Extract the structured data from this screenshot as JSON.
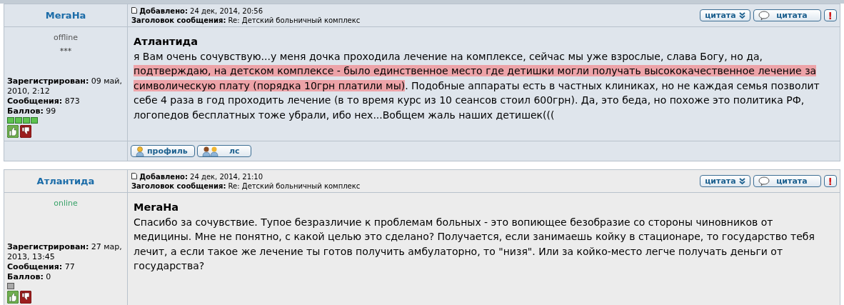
{
  "posts": [
    {
      "author": "MeraHa",
      "online": false,
      "status": "offline",
      "rank_text": "***",
      "registered_label": "Зарегистрирован:",
      "registered": "09 май, 2010, 2:12",
      "messages_label": "Сообщения:",
      "messages": "873",
      "points_label": "Баллов:",
      "points": "99",
      "rank_pips": [
        {
          "filled": true
        },
        {
          "filled": true
        },
        {
          "filled": true
        },
        {
          "filled": true
        }
      ],
      "added_label": "Добавлено:",
      "added": "24 дек, 2014, 20:56",
      "subject_label": "Заголовок сообщения:",
      "subject": "Re: Детский больничный комплекс",
      "quote_multi": "цитата",
      "quote": "цитата",
      "report": "!",
      "addressee": "Атлантида",
      "body": [
        {
          "text": "я Вам очень сочувствую...у меня дочка проходила лечение на комплексе, сейчас мы уже взрослые, слава Богу, но да, ",
          "highlighted": false
        },
        {
          "text": "подтверждаю, на детском комплексе - было единственное место где детишки могли получать высококачественное лечение за символическую плату (порядка 10грн платили мы)",
          "highlighted": true
        },
        {
          "text": ". Подобные аппараты есть в частных клиниках, но не каждая семья позволит себе 4 раза в год проходить лечение (в то время курс из 10 сеансов стоил 600грн). Да, это беда, но похоже это политика РФ, логопедов бесплатных тоже убрали, ибо нех...Вобщем жаль наших детишек(((",
          "highlighted": false
        }
      ],
      "footer": {
        "profile": "профиль",
        "pm": "лс"
      }
    },
    {
      "author": "Атлантида",
      "online": true,
      "status": "online",
      "registered_label": "Зарегистрирован:",
      "registered": "27 мар, 2013, 13:45",
      "messages_label": "Сообщения:",
      "messages": "77",
      "points_label": "Баллов:",
      "points": "0",
      "rank_pips": [
        {
          "filled": false
        }
      ],
      "added_label": "Добавлено:",
      "added": "24 дек, 2014, 21:10",
      "subject_label": "Заголовок сообщения:",
      "subject": "Re: Детский больничный комплекс",
      "quote_multi": "цитата",
      "quote": "цитата",
      "report": "!",
      "addressee": "MeraHa",
      "body": [
        {
          "text": "Спасибо за сочувствие. Тупое безразличие к проблемам больных - это вопиющее безобразие со стороны чиновников от медицины. Мне не понятно, с какой целью это сделано? Получается, если занимаешь койку в стационаре, то государство тебя лечит, а если такое же лечение ты готов получить амбулаторно, то \"низя\". Или за койко-место легче получать деньги от государства?",
          "highlighted": false
        }
      ]
    }
  ]
}
